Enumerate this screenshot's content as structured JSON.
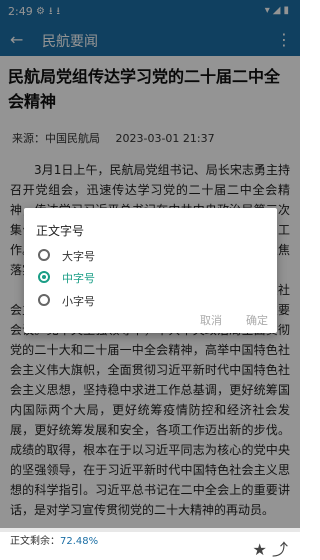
{
  "status_bar": {
    "time": "2:49",
    "left_icons": [
      "settings-icon",
      "download-icon",
      "download-icon"
    ],
    "right_icons": [
      "wifi-icon",
      "signal-icon",
      "battery-icon"
    ]
  },
  "app_bar": {
    "back_icon": "arrow-left-icon",
    "title": "民航要闻",
    "menu_icon": "more-vert-icon",
    "color": "#1c6fa5"
  },
  "article": {
    "title": "民航局党组传达学习党的二十届二中全会精神",
    "source": "来源：中国民航局",
    "date": "2023-03-01 21:37",
    "paragraphs": [
      "3月1日上午，民航局党组书记、局长宋志勇主持召开党组会，迅速传达学习党的二十届二中全会精神，传达学习习近平总书记在中共中央政治局第三次集体学习时的重要讲话精神，研究部署贯彻落实工作。局党组成员出席会议并进行交流发言。拉着聚焦落实主要任务，研究部署贯彻落实措施。",
      "会议认为，党的二十届二中全会是在全面建设社会主义现代化国家开局起步关键时期召开的一次重要会议。党中央坚强领导下，中共中央政治局全面贯彻党的二十大和二十届一中全会精神，高举中国特色社会主义伟大旗帜，全面贯彻习近平新时代中国特色社会主义思想，坚持稳中求进工作总基调，更好统筹国内国际两个大局，更好统筹疫情防控和经济社会发展，更好统筹发展和安全，各项工作迈出新的步伐。成绩的取得，根本在于以习近平同志为核心的党中央的坚强领导，在于习近平新时代中国特色社会主义思想的科学指引。习近平总书记在二中全会上的重要讲话，是对学习宣传贯彻党的二十大精神的再动员。"
    ]
  },
  "dialog": {
    "title": "正文字号",
    "options": [
      {
        "label": "大字号",
        "selected": false
      },
      {
        "label": "中字号",
        "selected": true
      },
      {
        "label": "小字号",
        "selected": false
      }
    ],
    "cancel_label": "取消",
    "ok_label": "确定",
    "accent": "#1a9e86"
  },
  "bottom_bar": {
    "progress_label": "正文剩余：",
    "progress_value": "72.48%",
    "icons": [
      "star-icon",
      "share-icon"
    ]
  }
}
